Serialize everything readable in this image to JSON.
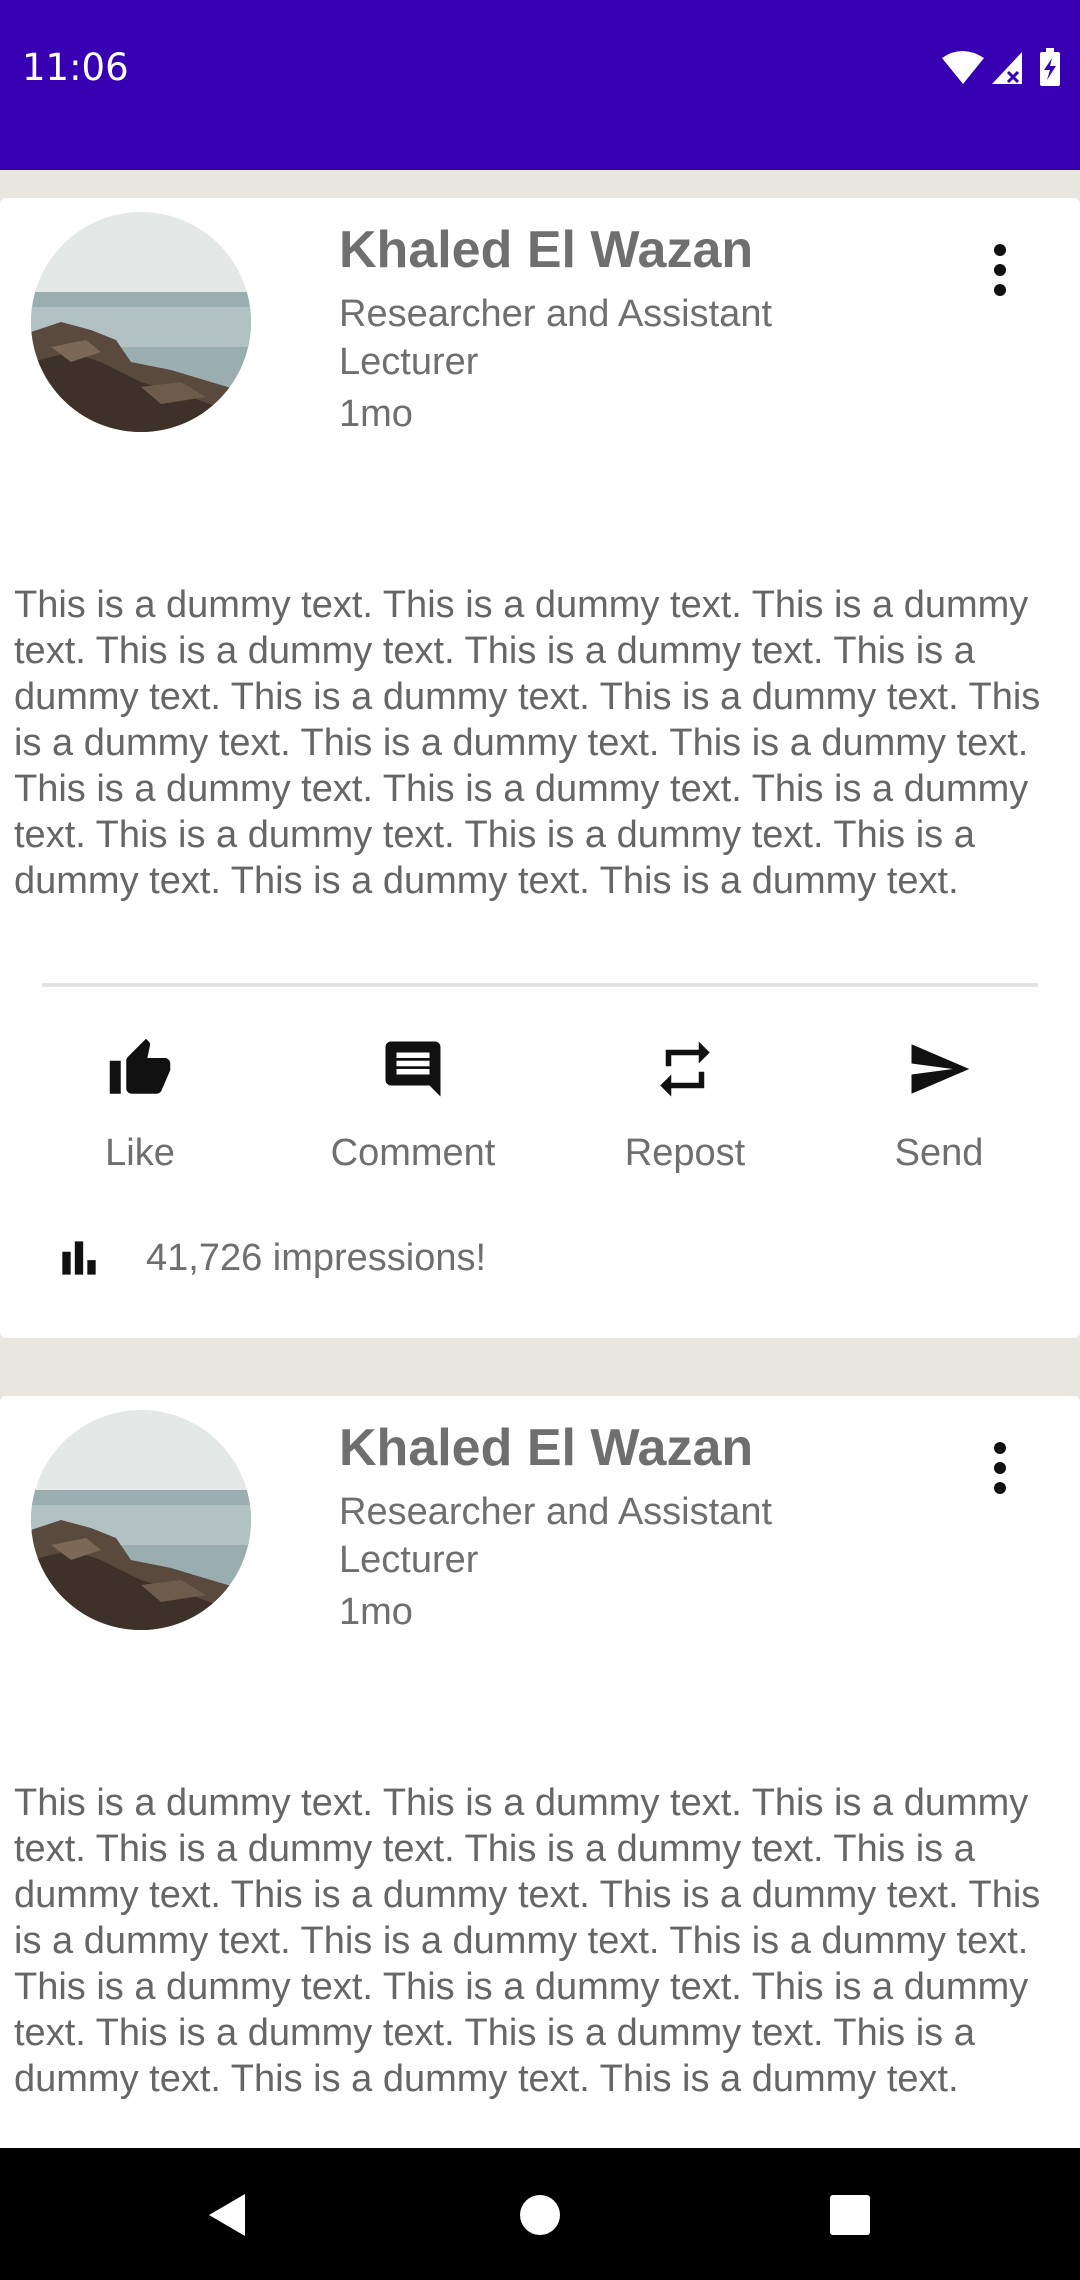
{
  "status_bar": {
    "time": "11:06",
    "background": "#3700b3",
    "icons": [
      "wifi-icon",
      "signal-icon",
      "battery-charging-icon"
    ]
  },
  "posts": [
    {
      "author": "Khaled El Wazan",
      "title": "Researcher and Assistant Lecturer",
      "time": "1mo",
      "body": "This is a dummy text. This is a dummy text. This is a dummy text. This is a dummy text. This is a dummy text. This is a dummy text. This is a dummy text. This is a dummy text. This is a dummy text. This is a dummy text. This is a dummy text. This is a dummy text. This is a dummy text. This is a dummy text. This is a dummy text. This is a dummy text. This is a dummy text. This is a dummy text. This is a dummy text.",
      "actions": {
        "like": "Like",
        "comment": "Comment",
        "repost": "Repost",
        "send": "Send"
      },
      "impressions": "41,726 impressions!"
    },
    {
      "author": "Khaled El Wazan",
      "title": "Researcher and Assistant Lecturer",
      "time": "1mo",
      "body": "This is a dummy text. This is a dummy text. This is a dummy text. This is a dummy text. This is a dummy text. This is a dummy text. This is a dummy text. This is a dummy text. This is a dummy text. This is a dummy text. This is a dummy text. This is a dummy text. This is a dummy text. This is a dummy text. This is a dummy text. This is a dummy text. This is a dummy text. This is a dummy text. This is a dummy text."
    }
  ],
  "nav_bar": {
    "icons": [
      "back-icon",
      "home-icon",
      "recents-icon"
    ]
  }
}
